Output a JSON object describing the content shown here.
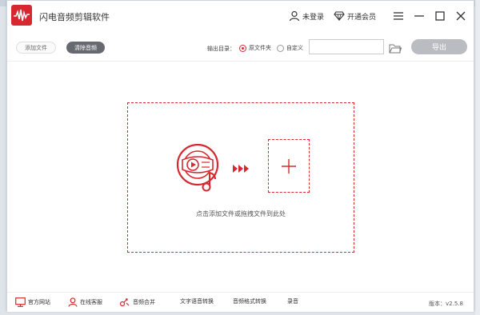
{
  "app": {
    "title": "闪电音频剪辑软件",
    "accent_color": "#d7282f",
    "logo_icon": "red-audio-waveform-logo"
  },
  "titlebar": {
    "login_label": "未登录",
    "vip_label": "开通会员",
    "icons": [
      "user-icon",
      "diamond-icon",
      "menu-icon",
      "minimize-icon",
      "maximize-icon",
      "close-icon"
    ]
  },
  "toolbar": {
    "add_file_label": "添加文件",
    "clear_audio_label": "清除音频",
    "output_dir_label": "输出目录：",
    "radio_original_label": "原文件夹",
    "radio_custom_label": "自定义",
    "output_path_value": "",
    "selected_output": "原文件夹",
    "export_label": "导出"
  },
  "dropzone": {
    "hint": "点击添加文件或拖拽文件到此处"
  },
  "footer": {
    "website_label": "官方网站",
    "service_label": "在线客服",
    "merge_label": "音频合并",
    "tts_label": "文字语音转换",
    "format_label": "音频格式转换",
    "record_label": "录音",
    "version_label": "版本：",
    "version_value": "v2.5.8"
  }
}
